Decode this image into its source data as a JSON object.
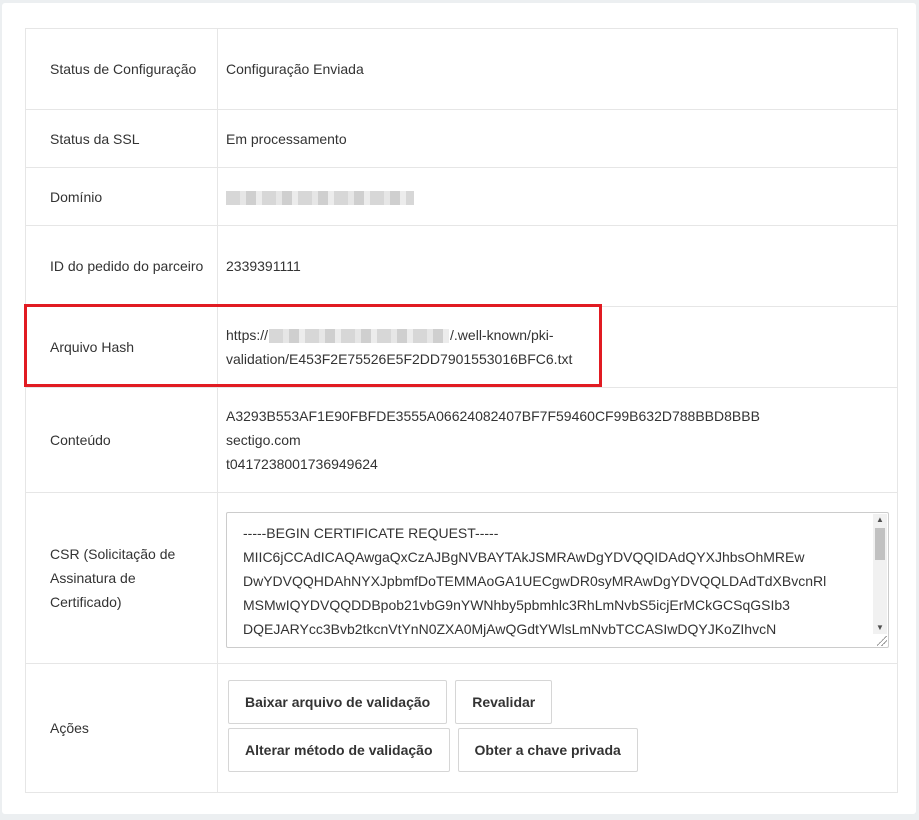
{
  "details": {
    "config_status": {
      "label": "Status de Configuração",
      "value": "Configuração Enviada"
    },
    "ssl_status": {
      "label": "Status da SSL",
      "value": "Em processamento"
    },
    "domain": {
      "label": "Domínio"
    },
    "partner_order_id": {
      "label": "ID do pedido do parceiro",
      "value": "2339391111"
    },
    "hash_file": {
      "label": "Arquivo Hash",
      "url_prefix": "https://",
      "url_suffix_line1": "/.well-known/pki-",
      "url_suffix_line2": "validation/E453F2E75526E5F2DD7901553016BFC6.txt"
    },
    "content": {
      "label": "Conteúdo",
      "line1": "A3293B553AF1E90FBFDE3555A06624082407BF7F59460CF99B632D788BBD8BBB",
      "line2": "sectigo.com",
      "line3": "t0417238001736949624"
    },
    "csr": {
      "label": "CSR (Solicitação de Assinatura de Certificado)",
      "text": "-----BEGIN CERTIFICATE REQUEST-----\nMIIC6jCCAdICAQAwgaQxCzAJBgNVBAYTAkJSMRAwDgYDVQQIDAdQYXJhbsOhMREw\nDwYDVQQHDAhNYXJpbmfDoTEMMAoGA1UECgwDR0syMRAwDgYDVQQLDAdTdXBvcnRl\nMSMwIQYDVQQDDBpob21vbG9nYWNhby5pbmhlc3RhLmNvbS5icjErMCkGCSqGSIb3\nDQEJARYcc3Bvb2tkcnVtYnN0ZXA0MjAwQGdtYWlsLmNvbTCCASIwDQYJKoZIhvcN"
    },
    "actions": {
      "label": "Ações",
      "buttons": [
        "Baixar arquivo de validação",
        "Revalidar",
        "Alterar método de validação",
        "Obter a chave privada"
      ]
    }
  },
  "colors": {
    "highlight": "#e11b22",
    "border": "#e6e6e6",
    "text": "#333333"
  }
}
